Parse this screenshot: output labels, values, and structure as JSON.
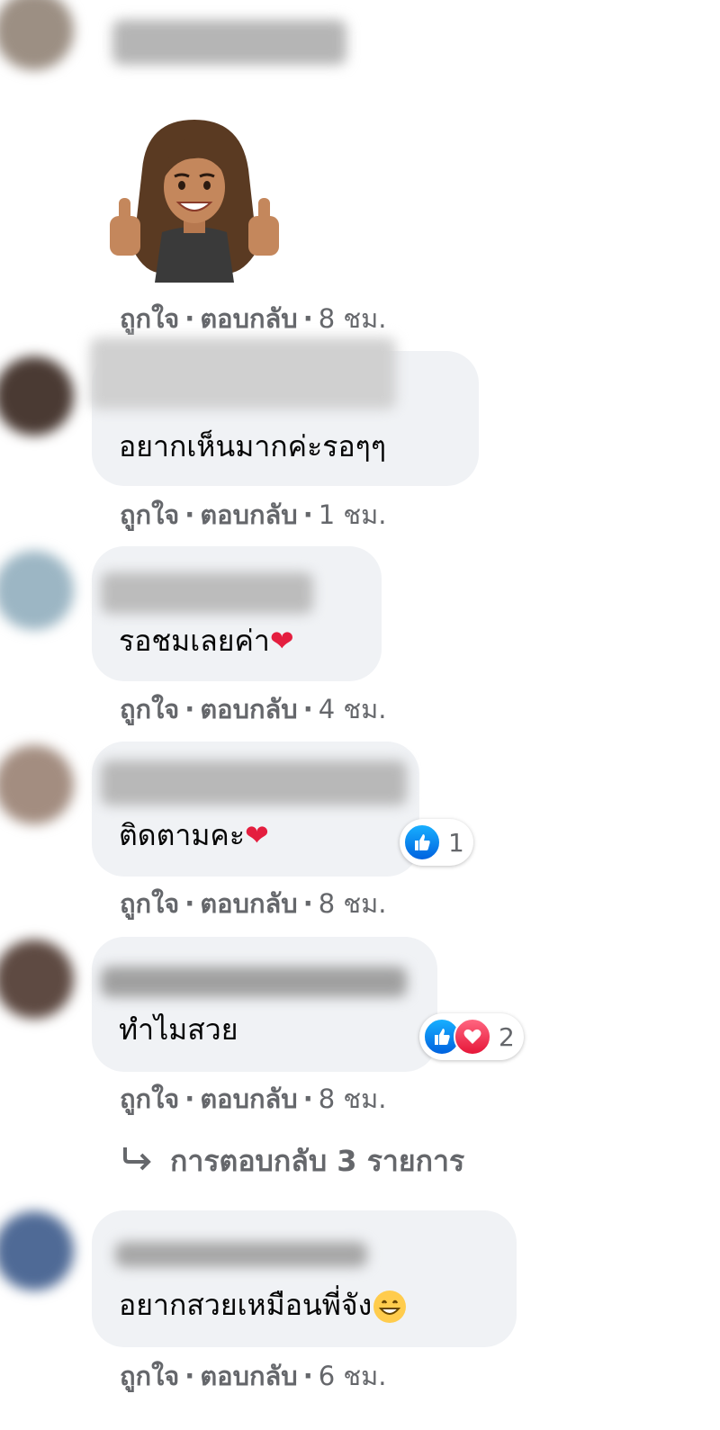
{
  "colors": {
    "bubble_bg": "#f0f2f5",
    "meta_text": "#65676b",
    "like_blue": "#1877f2",
    "love_red": "#e41e3f"
  },
  "comments": [
    {
      "sticker": "avatar-thumbs-up-sticker",
      "like": "ถูกใจ",
      "dot1": "·",
      "reply": "ตอบกลับ",
      "dot2": "·",
      "time": "8 ชม."
    },
    {
      "text": "อยากเห็นมากค่ะรอๆๆ",
      "like": "ถูกใจ",
      "dot1": "·",
      "reply": "ตอบกลับ",
      "dot2": "·",
      "time": "1 ชม."
    },
    {
      "text": "รอชมเลยค่า",
      "emoji": "heart",
      "like": "ถูกใจ",
      "dot1": "·",
      "reply": "ตอบกลับ",
      "dot2": "·",
      "time": "4 ชม."
    },
    {
      "text": "ติดตามคะ",
      "emoji": "heart",
      "reaction_count": "1",
      "like": "ถูกใจ",
      "dot1": "·",
      "reply": "ตอบกลับ",
      "dot2": "·",
      "time": "8 ชม."
    },
    {
      "text": "ทำไมสวย",
      "reaction_count": "2",
      "like": "ถูกใจ",
      "dot1": "·",
      "reply": "ตอบกลับ",
      "dot2": "·",
      "time": "8 ชม.",
      "replies_link": "การตอบกลับ 3 รายการ"
    },
    {
      "text": "อยากสวยเหมือนพี่จัง",
      "emoji": "grinning-face",
      "like": "ถูกใจ",
      "dot1": "·",
      "reply": "ตอบกลับ",
      "dot2": "·",
      "time": "6 ชม."
    }
  ]
}
